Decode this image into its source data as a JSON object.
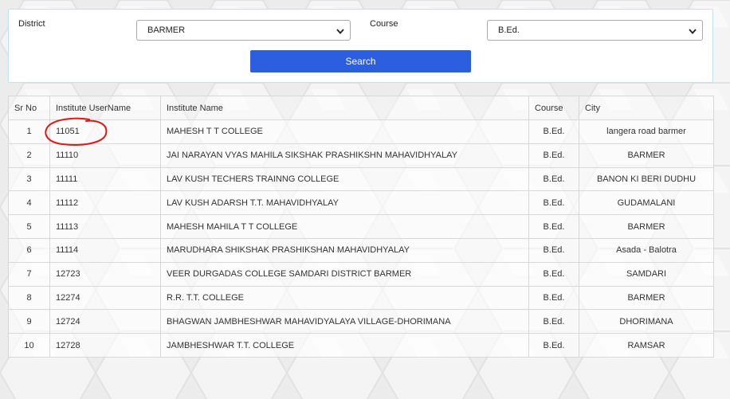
{
  "filters": {
    "district_label": "District",
    "district_value": "BARMER",
    "course_label": "Course",
    "course_value": "B.Ed.",
    "search_label": "Search"
  },
  "table": {
    "headers": {
      "sr_no": "Sr No",
      "username": "Institute UserName",
      "name": "Institute Name",
      "course": "Course",
      "city": "City"
    },
    "rows": [
      {
        "sr": "1",
        "username": "11051",
        "name": "MAHESH T T COLLEGE",
        "course": "B.Ed.",
        "city": "langera road barmer"
      },
      {
        "sr": "2",
        "username": "11110",
        "name": "JAI NARAYAN VYAS MAHILA SIKSHAK PRASHIKSHN MAHAVIDHYALAY",
        "course": "B.Ed.",
        "city": "BARMER"
      },
      {
        "sr": "3",
        "username": "11111",
        "name": "LAV KUSH TECHERS TRAINNG COLLEGE",
        "course": "B.Ed.",
        "city": "BANON KI BERI DUDHU"
      },
      {
        "sr": "4",
        "username": "11112",
        "name": "LAV KUSH ADARSH T.T. MAHAVIDHYALAY",
        "course": "B.Ed.",
        "city": "GUDAMALANI"
      },
      {
        "sr": "5",
        "username": "11113",
        "name": "MAHESH MAHILA T T COLLEGE",
        "course": "B.Ed.",
        "city": "BARMER"
      },
      {
        "sr": "6",
        "username": "11114",
        "name": "MARUDHARA SHIKSHAK PRASHIKSHAN MAHAVIDHYALAY",
        "course": "B.Ed.",
        "city": "Asada - Balotra"
      },
      {
        "sr": "7",
        "username": "12723",
        "name": "VEER DURGADAS COLLEGE SAMDARI DISTRICT BARMER",
        "course": "B.Ed.",
        "city": "SAMDARI"
      },
      {
        "sr": "8",
        "username": "12274",
        "name": "R.R. T.T. COLLEGE",
        "course": "B.Ed.",
        "city": "BARMER"
      },
      {
        "sr": "9",
        "username": "12724",
        "name": "BHAGWAN JAMBHESHWAR MAHAVIDYALAYA VILLAGE-DHORIMANA",
        "course": "B.Ed.",
        "city": "DHORIMANA"
      },
      {
        "sr": "10",
        "username": "12728",
        "name": "JAMBHESHWAR T.T. COLLEGE",
        "course": "B.Ed.",
        "city": "RAMSAR"
      }
    ]
  },
  "colors": {
    "search_button": "#2c5fe0",
    "annotation": "#e01818"
  }
}
